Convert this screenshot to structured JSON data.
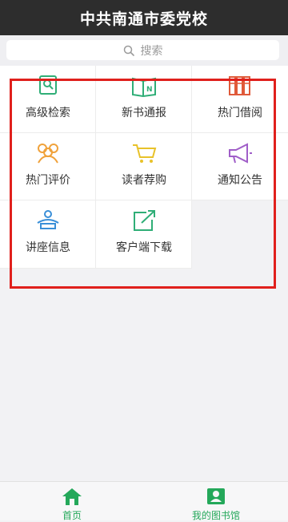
{
  "header": {
    "title": "中共南通市委党校"
  },
  "search": {
    "placeholder": "搜索"
  },
  "grid": {
    "items": [
      {
        "label": "高级检索",
        "icon": "search-icon"
      },
      {
        "label": "新书通报",
        "icon": "new-book-icon"
      },
      {
        "label": "热门借阅",
        "icon": "books-shelf-icon"
      },
      {
        "label": "热门评价",
        "icon": "people-icon"
      },
      {
        "label": "读者荐购",
        "icon": "cart-icon"
      },
      {
        "label": "通知公告",
        "icon": "megaphone-icon"
      },
      {
        "label": "讲座信息",
        "icon": "lecture-icon"
      },
      {
        "label": "客户端下载",
        "icon": "download-icon"
      }
    ]
  },
  "tabbar": {
    "home": {
      "label": "首页",
      "icon": "home-icon"
    },
    "my_library": {
      "label": "我的图书馆",
      "icon": "user-card-icon"
    }
  },
  "colors": {
    "header_bg": "#2d2d2d",
    "accent_green": "#24a85a",
    "highlight_red": "#e0201c"
  }
}
